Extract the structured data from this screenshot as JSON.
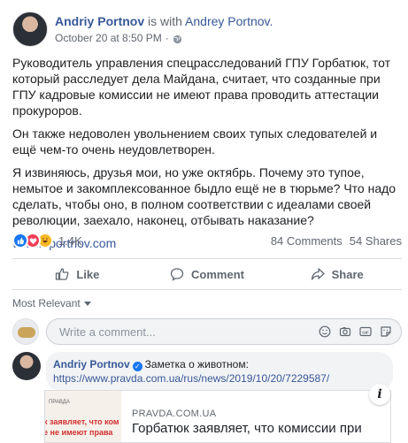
{
  "post": {
    "author": "Andriy Portnov",
    "with_text": "is with",
    "tagged": "Andrey Portnov.",
    "date": "October 20 at 8:50 PM",
    "separator": "·",
    "paragraphs": [
      "Руководитель управления спецрасследований ГПУ Горбатюк, тот который расследует дела Майдана, считает, что созданные при ГПУ кадровые комиссии не имеют права проводить аттестации прокуроров.",
      "Он также недоволен увольнением своих тупых следователей и ещё чем-то очень неудовлетворен.",
      "Я извиняюсь, друзья мои, но уже октябрь. Почему это тупое, немытое и закомплексованное быдло ещё не в тюрьме? Что надо сделать, чтобы оно, в полном соответствии с идеалами своей революции, заехало, наконец, отбывать наказание?"
    ],
    "link": "www.aportnov.com"
  },
  "reactions": {
    "count": "1.4K",
    "comments": "84 Comments",
    "shares": "54 Shares",
    "icons": [
      "like-icon",
      "love-icon",
      "haha-icon"
    ],
    "colors": {
      "like": "#1877f2",
      "love": "#f33e58",
      "haha": "#f7b928"
    }
  },
  "actions": {
    "like": "Like",
    "comment": "Comment",
    "share": "Share"
  },
  "sort": {
    "label": "Most Relevant"
  },
  "write_comment": {
    "placeholder": "Write a comment..."
  },
  "comment": {
    "author": "Andriy Portnov",
    "text": "Заметка о животном:",
    "link": "https://www.pravda.com.ua/rus/news/2019/10/20/7229587/",
    "preview": {
      "thumb_brand": "ПРАВДА",
      "thumb_line1": "к заявляет, что ком",
      "thumb_line2": "е не имеют права",
      "domain": "PRAVDA.COM.UA",
      "title": "Горбатюк заявляет, что комиссии при"
    }
  }
}
